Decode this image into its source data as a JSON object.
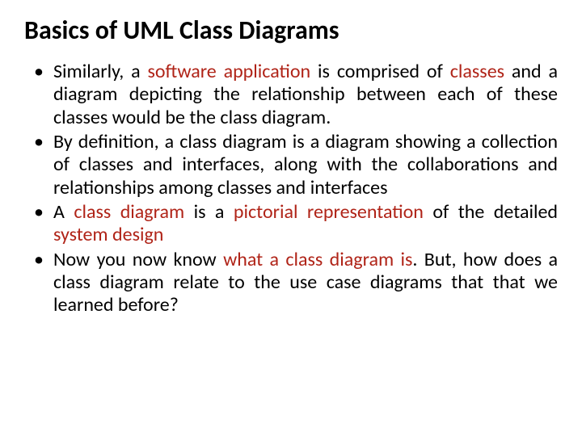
{
  "title": "Basics of UML Class Diagrams",
  "bullets": {
    "b1": {
      "pre": "Similarly, a ",
      "hl1": "software application",
      "mid": " is comprised of ",
      "hl2": "classes",
      "post": " and a diagram depicting the relationship between each of these classes would be the class diagram."
    },
    "b2": {
      "text": "By definition, a class diagram is a diagram showing a collection of classes and interfaces, along with the collaborations and relationships among classes and interfaces"
    },
    "b3": {
      "pre": "A ",
      "hl1": "class diagram",
      "mid": " is a ",
      "hl2": "pictorial representation",
      "post1": " of the detailed ",
      "hl3": "system design"
    },
    "b4": {
      "pre": "Now you now know ",
      "hl1": "what a class diagram is",
      "post": ". But, how does a class diagram relate to the use case diagrams that that we learned before?"
    }
  }
}
